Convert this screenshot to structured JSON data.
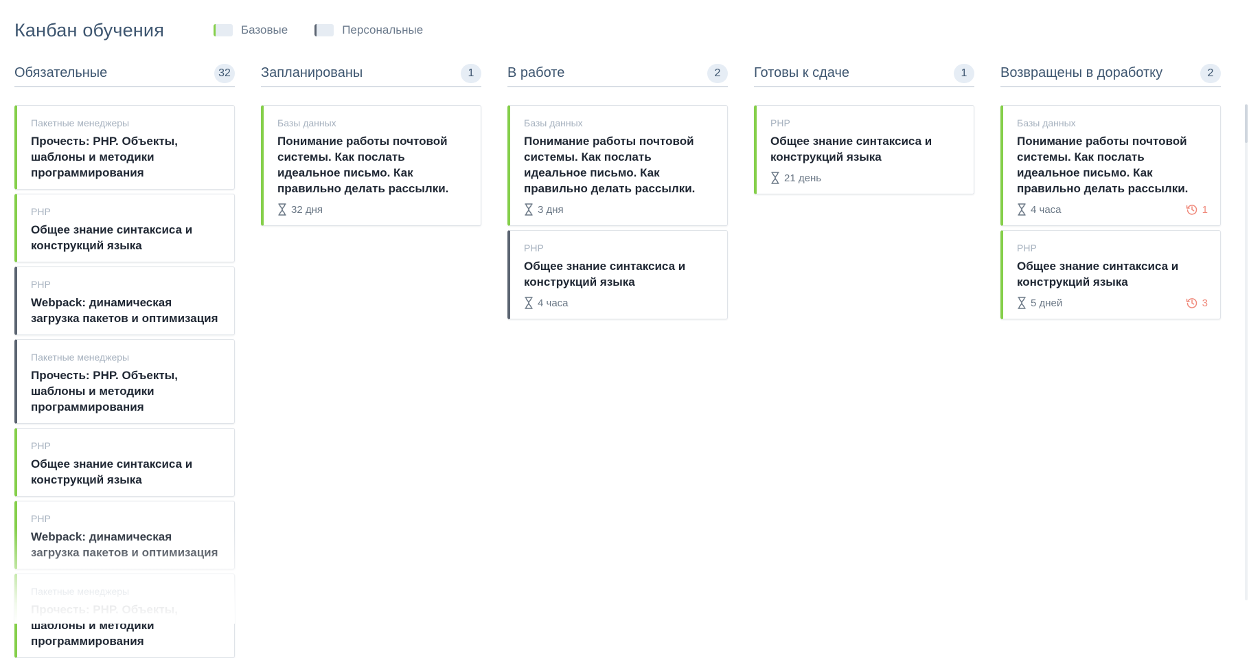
{
  "page": {
    "title": "Канбан обучения",
    "legend": [
      {
        "label": "Базовые",
        "color": "#85cf4a"
      },
      {
        "label": "Персональные",
        "color": "#5b6471"
      }
    ]
  },
  "columns": [
    {
      "title": "Обязательные",
      "count": "32",
      "cards": [
        {
          "category": "Пакетные менеджеры",
          "title": "Прочесть: PHP. Объекты, шаблоны и методики программирования",
          "kind": "basic"
        },
        {
          "category": "PHP",
          "title": "Общее знание синтаксиса и конструкций языка",
          "kind": "basic"
        },
        {
          "category": "PHP",
          "title": "Webpack: динамическая загрузка пакетов и оптимизация",
          "kind": "personal"
        },
        {
          "category": "Пакетные менеджеры",
          "title": "Прочесть: PHP. Объекты, шаблоны и методики программирования",
          "kind": "personal"
        },
        {
          "category": "PHP",
          "title": "Общее знание синтаксиса и конструкций языка",
          "kind": "basic"
        },
        {
          "category": "PHP",
          "title": "Webpack: динамическая загрузка пакетов и оптимизация",
          "kind": "basic"
        },
        {
          "category": "Пакетные менеджеры",
          "title": "Прочесть: PHP. Объекты, шаблоны и методики программирования",
          "kind": "basic"
        }
      ]
    },
    {
      "title": "Запланированы",
      "count": "1",
      "cards": [
        {
          "category": "Базы данных",
          "title": "Понимание работы почтовой системы. Как послать идеальное письмо. Как правильно делать рассылки.",
          "kind": "basic",
          "time": "32 дня"
        }
      ]
    },
    {
      "title": "В работе",
      "count": "2",
      "cards": [
        {
          "category": "Базы данных",
          "title": "Понимание работы почтовой системы. Как послать идеальное письмо. Как правильно делать рассылки.",
          "kind": "basic",
          "time": "3 дня"
        },
        {
          "category": "PHP",
          "title": "Общее знание синтаксиса и конструкций языка",
          "kind": "personal",
          "time": "4 часа"
        }
      ]
    },
    {
      "title": "Готовы к сдаче",
      "count": "1",
      "cards": [
        {
          "category": "PHP",
          "title": "Общее знание синтаксиса и конструкций языка",
          "kind": "basic",
          "time": "21 день"
        }
      ]
    },
    {
      "title": "Возвращены в доработку",
      "count": "2",
      "cards": [
        {
          "category": "Базы данных",
          "title": "Понимание работы почтовой системы. Как послать идеальное письмо. Как правильно делать рассылки.",
          "kind": "basic",
          "time": "4 часа",
          "returns": "1"
        },
        {
          "category": "PHP",
          "title": "Общее знание синтаксиса и конструкций языка",
          "kind": "basic",
          "time": "5 дней",
          "returns": "3"
        }
      ]
    }
  ]
}
